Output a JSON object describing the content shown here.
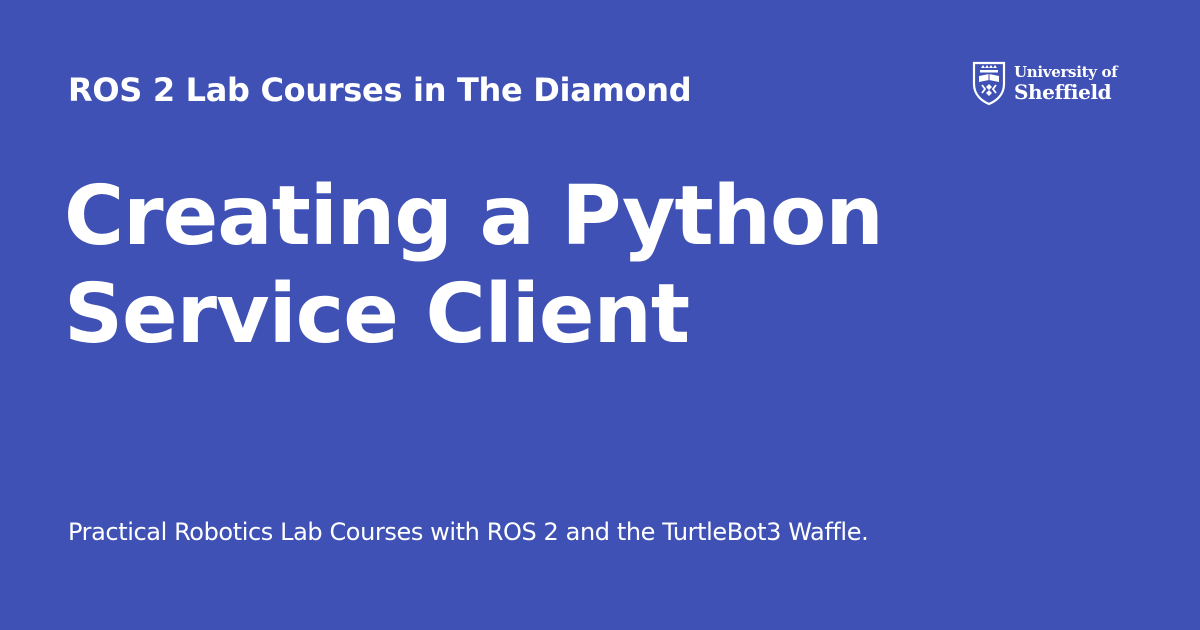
{
  "header": {
    "site_name": "ROS 2 Lab Courses in The Diamond"
  },
  "logo": {
    "line1": "University of",
    "line2": "Sheffield"
  },
  "main": {
    "title": "Creating a Python Service Client",
    "description": "Practical Robotics Lab Courses with ROS 2 and the TurtleBot3 Waffle."
  },
  "colors": {
    "background": "#3f51b5",
    "text": "#ffffff"
  }
}
